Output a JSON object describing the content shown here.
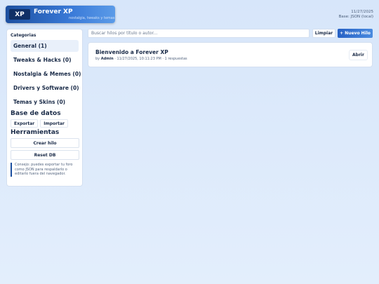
{
  "header": {
    "logo": "XP",
    "title": "Forever XP",
    "subtitle": "nostalgia, tweaks y temas"
  },
  "meta": {
    "date": "11/27/2025",
    "base": "Base: JSON (local)"
  },
  "sidebar": {
    "categories_label": "Categorias",
    "categories": [
      {
        "label": "General (1)",
        "active": true
      },
      {
        "label": "Tweaks & Hacks (0)",
        "active": false
      },
      {
        "label": "Nostalgia & Memes (0)",
        "active": false
      },
      {
        "label": "Drivers y Software (0)",
        "active": false
      },
      {
        "label": "Temas y Skins (0)",
        "active": false
      }
    ],
    "database_heading": "Base de datos",
    "export_label": "Exportar",
    "import_label": "Importar",
    "tools_heading": "Herramientas",
    "create_thread_label": "Crear hilo",
    "reset_db_label": "Reset DB",
    "tip": "Consejo: puedes exportar tu foro como JSON para respaldarlo o editarlo fuera del navegador."
  },
  "toolbar": {
    "search_placeholder": "Buscar hilos por título o autor...",
    "search_value": "",
    "clear_label": "Limpiar",
    "new_thread_label": "+ Nuevo Hilo"
  },
  "threads": [
    {
      "title": "Bienvenido a Forever XP",
      "by_prefix": "by",
      "author": "Admin",
      "details": " · 11/27/2025, 10:11:23 PM · 1 respuestas",
      "open_label": "Abrir"
    }
  ],
  "colors": {
    "accent": "#2761c4",
    "header_dark": "#1c4fa0"
  }
}
